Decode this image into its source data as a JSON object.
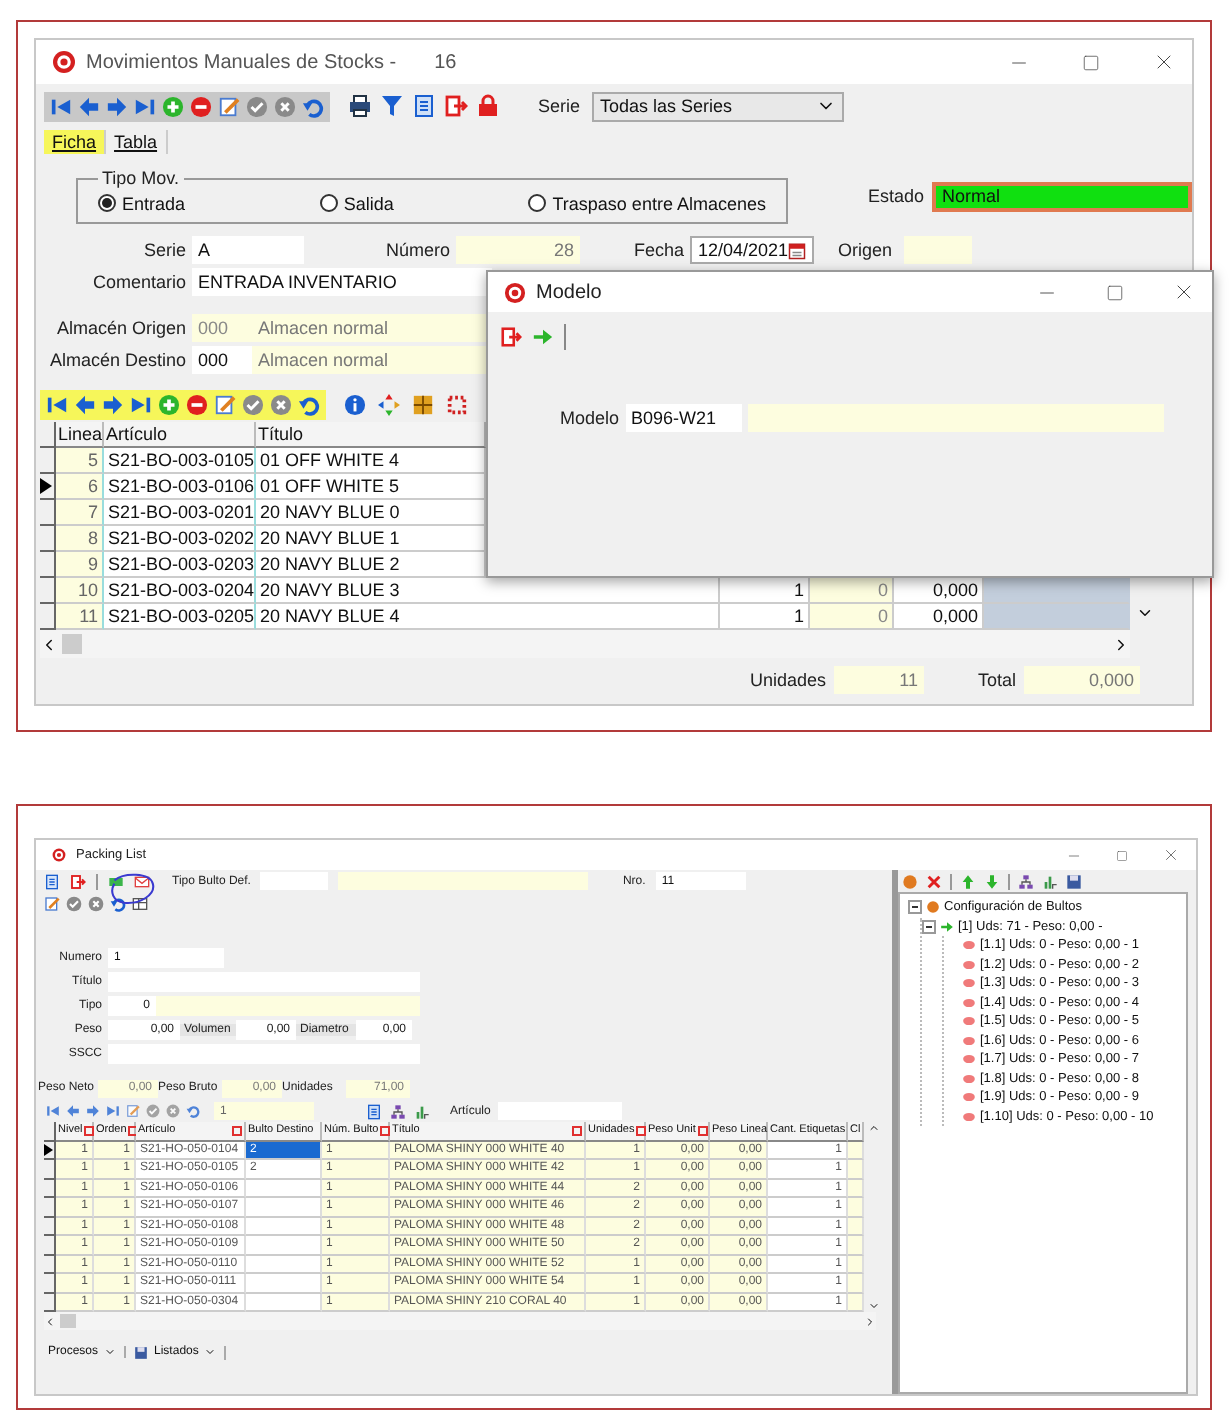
{
  "movimientos_window": {
    "title": "Movimientos Manuales de Stocks -",
    "number": "16",
    "serie_filter": {
      "label": "Serie",
      "value": "Todas las Series"
    },
    "tabs": [
      {
        "label": "Ficha",
        "selected": true
      },
      {
        "label": "Tabla",
        "selected": false
      }
    ],
    "tipo_mov": {
      "legend": "Tipo Mov.",
      "options": [
        {
          "label": "Entrada",
          "selected": true
        },
        {
          "label": "Salida",
          "selected": false
        },
        {
          "label": "Traspaso entre Almacenes",
          "selected": false
        }
      ]
    },
    "estado": {
      "label": "Estado",
      "value": "Normal"
    },
    "origen": {
      "label": "Origen"
    },
    "serie": {
      "label": "Serie",
      "value": "A"
    },
    "numero": {
      "label": "Número",
      "value": "28"
    },
    "fecha": {
      "label": "Fecha",
      "value": "12/04/2021"
    },
    "comentario": {
      "label": "Comentario",
      "value": "ENTRADA INVENTARIO"
    },
    "almacenes": [
      {
        "label": "Almacén Origen",
        "code": "000",
        "name": "Almacen normal"
      },
      {
        "label": "Almacén Destino",
        "code": "000",
        "name": "Almacen normal"
      }
    ],
    "table": {
      "columns": [
        "Linea",
        "Artículo",
        "Título"
      ],
      "rows": [
        {
          "cells": [
            "5",
            "S21-BO-003-0105",
            "01 OFF WHITE 4"
          ],
          "selected": false
        },
        {
          "cells": [
            "6",
            "S21-BO-003-0106",
            "01 OFF WHITE 5"
          ],
          "selected": true
        },
        {
          "cells": [
            "7",
            "S21-BO-003-0201",
            "20 NAVY BLUE 0"
          ],
          "selected": false
        },
        {
          "cells": [
            "8",
            "S21-BO-003-0202",
            "20 NAVY BLUE 1"
          ],
          "selected": false
        },
        {
          "cells": [
            "9",
            "S21-BO-003-0203",
            "20 NAVY BLUE 2"
          ],
          "selected": false
        },
        {
          "cells": [
            "10",
            "S21-BO-003-0204",
            "20 NAVY BLUE 3",
            "1",
            "0",
            "0,000"
          ],
          "selected": false
        },
        {
          "cells": [
            "11",
            "S21-BO-003-0205",
            "20 NAVY BLUE 4",
            "1",
            "0",
            "0,000"
          ],
          "selected": false
        }
      ]
    },
    "totals": [
      {
        "label": "Unidades",
        "value": "11"
      },
      {
        "label": "Total",
        "value": "0,000"
      }
    ]
  },
  "modelo_dialog": {
    "title": "Modelo",
    "field": {
      "label": "Modelo",
      "value": "B096-W21"
    }
  },
  "packing_window": {
    "title": "Packing List",
    "tipo_bulto": {
      "label": "Tipo Bulto Def."
    },
    "nro": {
      "label": "Nro.",
      "value": "11"
    },
    "form": {
      "numero": {
        "label": "Numero",
        "value": "1"
      },
      "titulo": {
        "label": "Título"
      },
      "tipo": {
        "label": "Tipo",
        "value": "0"
      },
      "peso": {
        "label": "Peso",
        "value": "0,00"
      },
      "volumen": {
        "label": "Volumen",
        "value": "0,00"
      },
      "diametro": {
        "label": "Diametro",
        "value": "0,00"
      },
      "sscc": {
        "label": "SSCC"
      }
    },
    "summary": [
      {
        "label": "Peso Neto",
        "value": "0,00"
      },
      {
        "label": "Peso Bruto",
        "value": "0,00"
      },
      {
        "label": "Unidades",
        "value": "71,00"
      }
    ],
    "nav_field": {
      "value": "1"
    },
    "articulo_filter": {
      "label": "Artículo"
    },
    "table": {
      "columns": [
        {
          "label": "Nivel",
          "marker": true
        },
        {
          "label": "Orden",
          "marker": true
        },
        {
          "label": "Artículo",
          "marker": true
        },
        {
          "label": "Bulto Destino",
          "marker": false
        },
        {
          "label": "Núm. Bulto",
          "marker": true
        },
        {
          "label": "Título",
          "marker": true
        },
        {
          "label": "Unidades",
          "marker": true
        },
        {
          "label": "Peso Unit",
          "marker": true
        },
        {
          "label": "Peso Linea",
          "marker": false
        },
        {
          "label": "Cant. Etiquetas",
          "marker": false
        },
        {
          "label": "Cl",
          "marker": false
        }
      ],
      "rows": [
        {
          "cells": [
            "1",
            "1",
            "S21-HO-050-0104",
            "2",
            "1",
            "PALOMA SHINY 000 WHITE 40",
            "1",
            "0,00",
            "0,00",
            "1"
          ],
          "selected": true
        },
        {
          "cells": [
            "1",
            "1",
            "S21-HO-050-0105",
            "2",
            "1",
            "PALOMA SHINY 000 WHITE 42",
            "1",
            "0,00",
            "0,00",
            "1"
          ],
          "selected": false
        },
        {
          "cells": [
            "1",
            "1",
            "S21-HO-050-0106",
            "",
            "1",
            "PALOMA SHINY 000 WHITE 44",
            "2",
            "0,00",
            "0,00",
            "1"
          ],
          "selected": false
        },
        {
          "cells": [
            "1",
            "1",
            "S21-HO-050-0107",
            "",
            "1",
            "PALOMA SHINY 000 WHITE 46",
            "2",
            "0,00",
            "0,00",
            "1"
          ],
          "selected": false
        },
        {
          "cells": [
            "1",
            "1",
            "S21-HO-050-0108",
            "",
            "1",
            "PALOMA SHINY 000 WHITE 48",
            "2",
            "0,00",
            "0,00",
            "1"
          ],
          "selected": false
        },
        {
          "cells": [
            "1",
            "1",
            "S21-HO-050-0109",
            "",
            "1",
            "PALOMA SHINY 000 WHITE 50",
            "2",
            "0,00",
            "0,00",
            "1"
          ],
          "selected": false
        },
        {
          "cells": [
            "1",
            "1",
            "S21-HO-050-0110",
            "",
            "1",
            "PALOMA SHINY 000 WHITE 52",
            "1",
            "0,00",
            "0,00",
            "1"
          ],
          "selected": false
        },
        {
          "cells": [
            "1",
            "1",
            "S21-HO-050-0111",
            "",
            "1",
            "PALOMA SHINY 000 WHITE 54",
            "1",
            "0,00",
            "0,00",
            "1"
          ],
          "selected": false
        },
        {
          "cells": [
            "1",
            "1",
            "S21-HO-050-0304",
            "",
            "1",
            "PALOMA SHINY 210 CORAL 40",
            "1",
            "0,00",
            "0,00",
            "1"
          ],
          "selected": false
        }
      ]
    },
    "bottom_menus": [
      "Procesos",
      "Listados"
    ],
    "tree": {
      "nodes": [
        {
          "label": "Configuración de Bultos",
          "expanded": true,
          "children": [
            {
              "label": "[1] Uds: 71 - Peso: 0,00 -",
              "expanded": true,
              "children": [
                {
                  "label": "[1.1] Uds: 0 - Peso: 0,00 - 1"
                },
                {
                  "label": "[1.2] Uds: 0 - Peso: 0,00 - 2"
                },
                {
                  "label": "[1.3] Uds: 0 - Peso: 0,00 - 3"
                },
                {
                  "label": "[1.4] Uds: 0 - Peso: 0,00 - 4"
                },
                {
                  "label": "[1.5] Uds: 0 - Peso: 0,00 - 5"
                },
                {
                  "label": "[1.6] Uds: 0 - Peso: 0,00 - 6"
                },
                {
                  "label": "[1.7] Uds: 0 - Peso: 0,00 - 7"
                },
                {
                  "label": "[1.8] Uds: 0 - Peso: 0,00 - 8"
                },
                {
                  "label": "[1.9] Uds: 0 - Peso: 0,00 - 9"
                },
                {
                  "label": "[1.10] Uds: 0 - Peso: 0,00 - 10"
                }
              ]
            }
          ]
        }
      ]
    }
  }
}
